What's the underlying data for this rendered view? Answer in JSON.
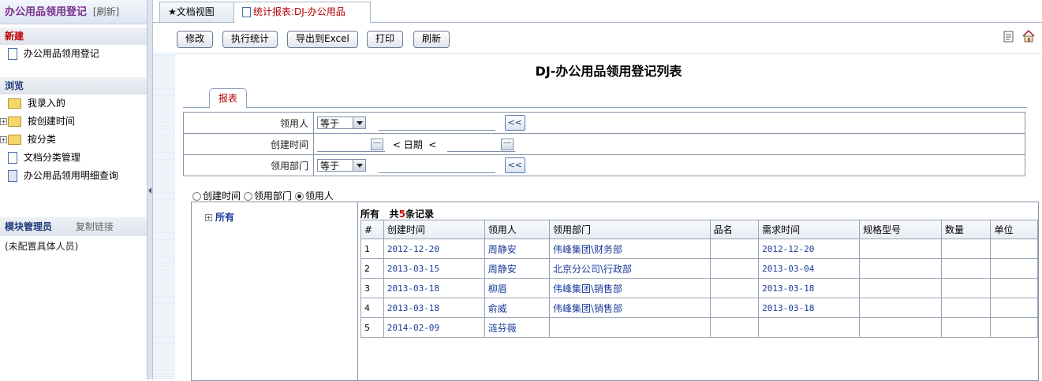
{
  "left": {
    "title": "办公用品领用登记",
    "refresh": "[刷新]",
    "new_section": "新建",
    "new_items": [
      "办公用品领用登记"
    ],
    "browse_section": "浏览",
    "browse_items": [
      "我录入的",
      "按创建时间",
      "按分类",
      "文档分类管理",
      "办公用品领用明细查询"
    ],
    "module_admin": "模块管理员",
    "copy_link": "复制链接",
    "no_person": "(未配置具体人员)"
  },
  "tabs": [
    "★文档视图",
    "统计报表:DJ-办公用品"
  ],
  "toolbar": {
    "edit": "修改",
    "run_stats": "执行统计",
    "export_excel": "导出到Excel",
    "print": "打印",
    "refresh": "刷新"
  },
  "report": {
    "title": "DJ-办公用品领用登记列表",
    "tab_label": "报表",
    "filters": {
      "recipient_label": "领用人",
      "recipient_op": "等于",
      "created_label": "创建时间",
      "date_lt": "<",
      "date_word": "日期",
      "dept_label": "领用部门",
      "dept_op": "等于",
      "go": "<<"
    },
    "group_by": {
      "options": [
        "创建时间",
        "领用部门",
        "领用人"
      ],
      "selected": "领用人"
    },
    "tree_root": "所有",
    "summary_prefix": "所有",
    "summary_total": "共",
    "summary_count": "5",
    "summary_suffix": "条记录",
    "columns": [
      "#",
      "创建时间",
      "领用人",
      "领用部门",
      "品名",
      "需求时间",
      "规格型号",
      "数量",
      "单位"
    ],
    "rows": [
      [
        "1",
        "2012-12-20",
        "周静安",
        "伟峰集团\\财务部",
        "",
        "2012-12-20",
        "",
        "",
        ""
      ],
      [
        "2",
        "2013-03-15",
        "周静安",
        "北京分公司\\行政部",
        "",
        "2013-03-04",
        "",
        "",
        ""
      ],
      [
        "3",
        "2013-03-18",
        "柳眉",
        "伟峰集团\\销售部",
        "",
        "2013-03-18",
        "",
        "",
        ""
      ],
      [
        "4",
        "2013-03-18",
        "俞威",
        "伟峰集团\\销售部",
        "",
        "2013-03-18",
        "",
        "",
        ""
      ],
      [
        "5",
        "2014-02-09",
        "涟芬薇",
        "",
        "",
        "",
        "",
        "",
        ""
      ]
    ]
  }
}
